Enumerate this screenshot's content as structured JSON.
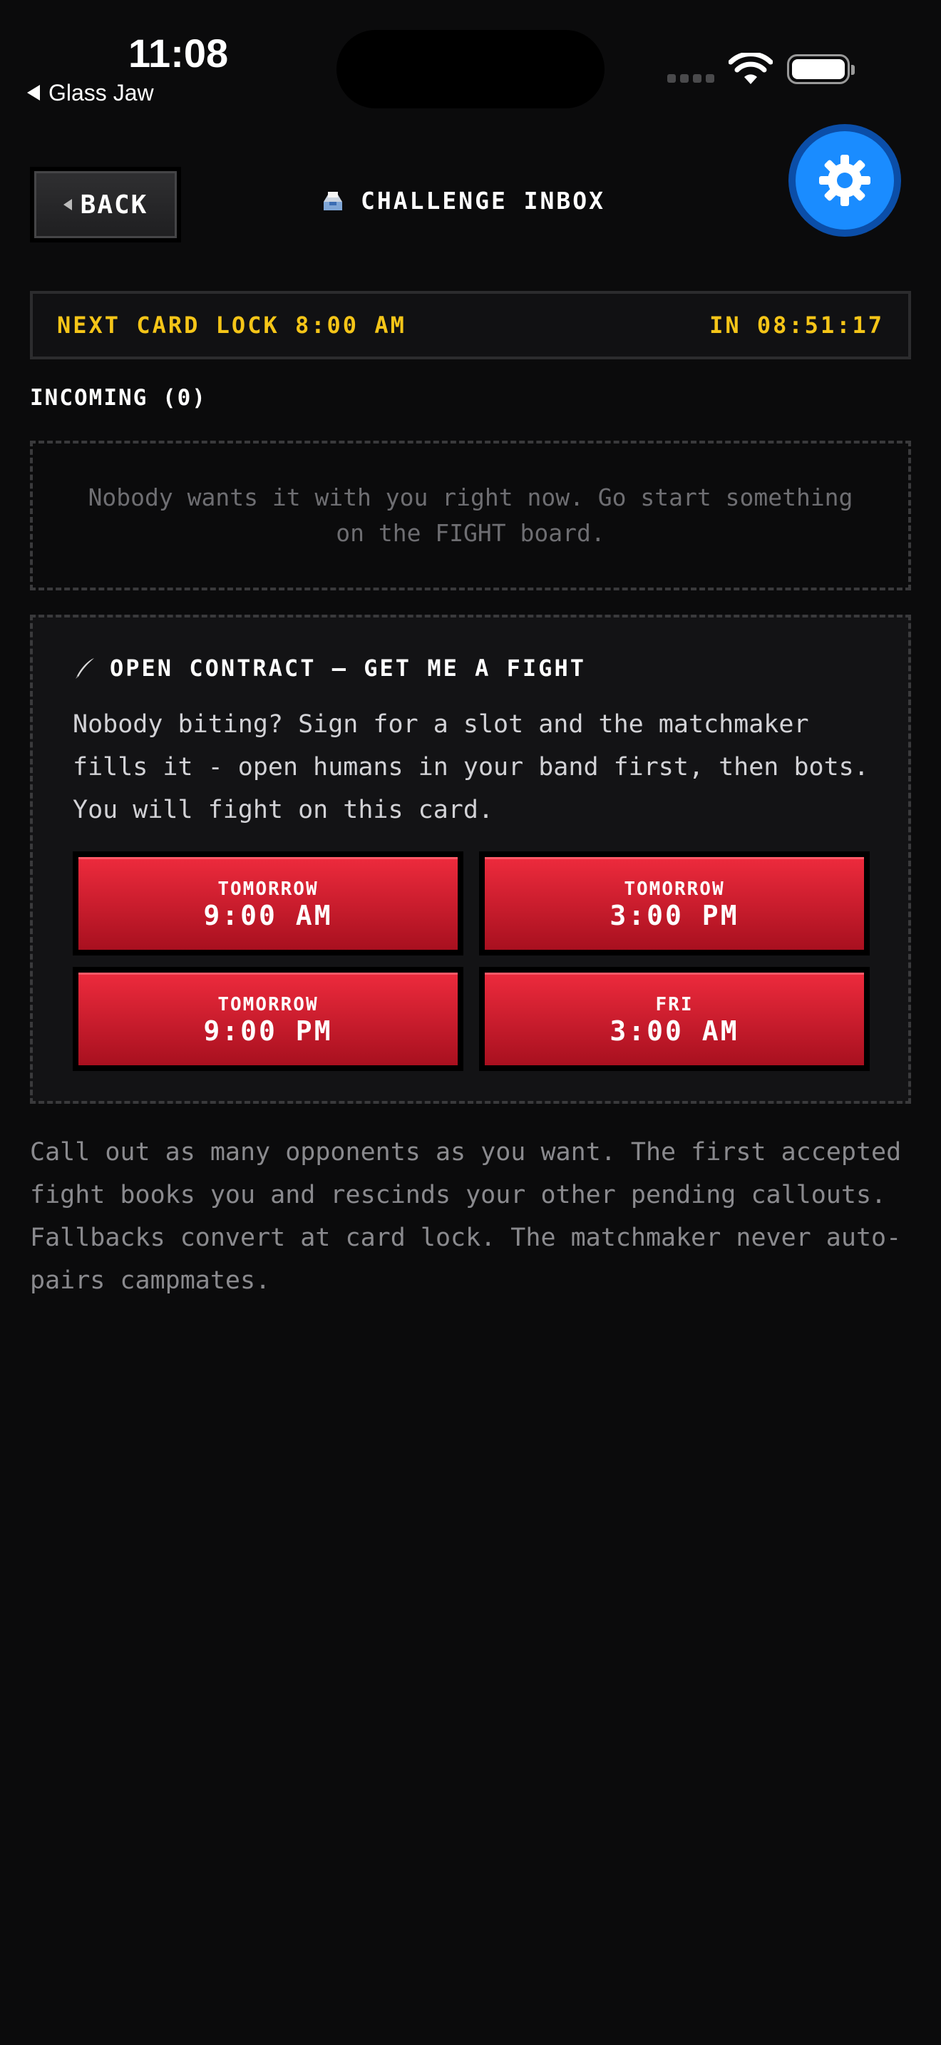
{
  "status_bar": {
    "time": "11:08",
    "back_app": "Glass Jaw"
  },
  "header": {
    "back_label": "BACK",
    "title": "CHALLENGE INBOX",
    "title_icon": "inbox-tray-icon",
    "settings_icon": "gear-icon"
  },
  "lock_banner": {
    "left": "NEXT CARD LOCK 8:00 AM",
    "right": "IN 08:51:17"
  },
  "incoming": {
    "label": "INCOMING (0)",
    "empty_message": "Nobody wants it with you right now. Go start something on the FIGHT board."
  },
  "open_contract": {
    "title": "OPEN CONTRACT — GET ME A FIGHT",
    "title_icon": "quill-icon",
    "description": "Nobody biting? Sign for a slot and the matchmaker fills it - open humans in your band first, then bots. You will fight on this card.",
    "slots": [
      {
        "day": "TOMORROW",
        "time": "9:00 AM"
      },
      {
        "day": "TOMORROW",
        "time": "3:00 PM"
      },
      {
        "day": "TOMORROW",
        "time": "9:00 PM"
      },
      {
        "day": "FRI",
        "time": "3:00 AM"
      }
    ]
  },
  "footer_note": "Call out as many opponents as you want. The first accepted fight books you and rescinds your other pending callouts. Fallbacks convert at card lock. The matchmaker never auto-pairs campmates.",
  "colors": {
    "background": "#0b0b0c",
    "accent_yellow": "#f5c518",
    "slot_red": "#e0202f",
    "settings_blue": "#1a8cff"
  }
}
